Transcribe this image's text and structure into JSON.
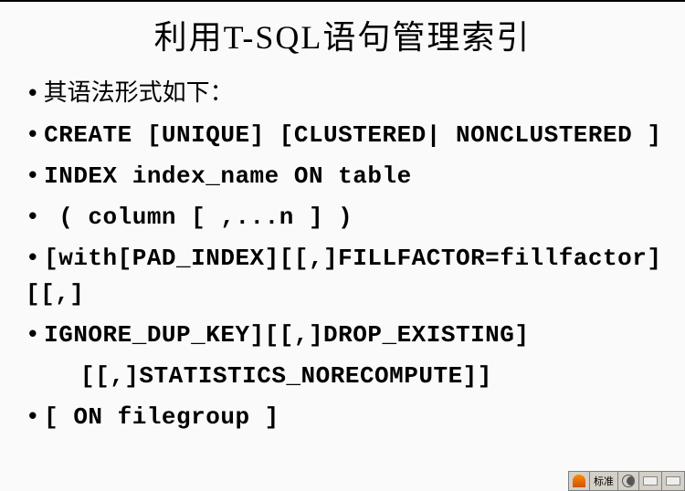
{
  "title": "利用T-SQL语句管理索引",
  "lines": {
    "intro": "其语法形式如下：",
    "l1": "CREATE      [UNIQUE]       [CLUSTERED| NONCLUSTERED ]",
    "l2": "INDEX index_name ON table",
    "l3": " ( column [ ,...n ] )",
    "l4": "[with[PAD_INDEX][[,]FILLFACTOR=fillfactor][[,]",
    "l5": "IGNORE_DUP_KEY][[,]DROP_EXISTING]",
    "l5b": "[[,]STATISTICS_NORECOMPUTE]]",
    "l6": "[ ON filegroup ]"
  },
  "statusbar": {
    "label": "标准"
  }
}
